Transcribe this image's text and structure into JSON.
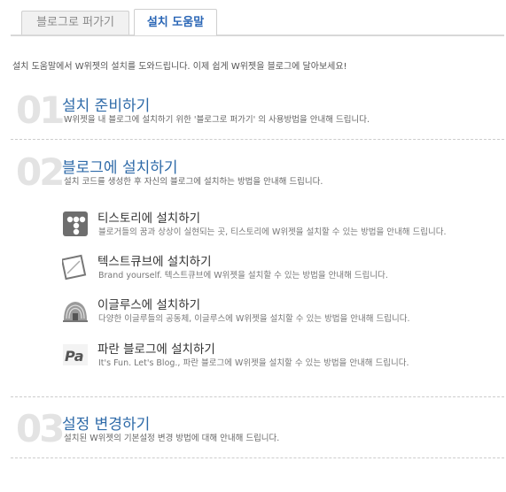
{
  "tabs": [
    {
      "label": "블로그로 퍼가기",
      "active": false
    },
    {
      "label": "설치 도움말",
      "active": true
    }
  ],
  "intro": "설치 도움말에서 W위젯의 설치를 도와드립니다. 이제 쉽게 W위젯을 블로그에 달아보세요!",
  "steps": [
    {
      "number": "01",
      "title": "설치 준비하기",
      "desc": "W위젯을 내 블로그에 설치하기 위한 '블로그로 퍼가기' 의 사용방법을 안내해 드립니다."
    },
    {
      "number": "02",
      "title": "블로그에 설치하기",
      "desc": "설치 코드를 생성한 후 자신의 블로그에 설치하는 방법을 안내해 드립니다."
    },
    {
      "number": "03",
      "title": "설정 변경하기",
      "desc": "설치된 W위젯의 기본설정 변경 방법에 대해 안내해 드립니다."
    }
  ],
  "platforms": [
    {
      "icon": "tistory-icon",
      "title": "티스토리에 설치하기",
      "desc": "블로거들의 꿈과 상상이 실현되는 곳, 티스토리에 W위젯을 설치할 수 있는 방법을 안내해 드립니다."
    },
    {
      "icon": "textcube-icon",
      "title": "텍스트큐브에 설치하기",
      "desc": "Brand yourself. 텍스트큐브에 W위젯을 설치할 수 있는 방법을 안내해 드립니다."
    },
    {
      "icon": "egloos-icon",
      "title": "이글루스에 설치하기",
      "desc": "다양한 이글루들의 공동체, 이글루스에 W위젯을 설치할 수 있는 방법을 안내해 드립니다."
    },
    {
      "icon": "paran-icon",
      "title": "파란 블로그에 설치하기",
      "desc": "It's Fun. Let's Blog., 파란 블로그에 W위젯을 설치할 수 있는 방법을 안내해 드립니다."
    }
  ],
  "colors": {
    "accent": "#2e6aa8",
    "tab_active": "#2b67b6",
    "step_number": "#e3e3e3",
    "separator": "#cccccc"
  }
}
